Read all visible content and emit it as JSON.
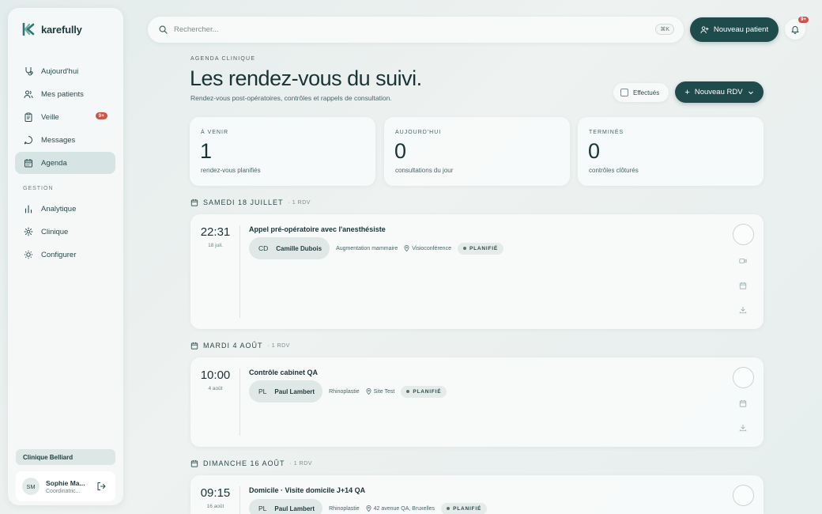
{
  "app": {
    "name": "karefully"
  },
  "sidebar": {
    "items": [
      {
        "label": "Aujourd'hui",
        "icon": "stethoscope-icon"
      },
      {
        "label": "Mes patients",
        "icon": "users-icon"
      },
      {
        "label": "Veille",
        "icon": "clipboard-icon",
        "badge": "9+"
      },
      {
        "label": "Messages",
        "icon": "message-icon"
      },
      {
        "label": "Agenda",
        "icon": "calendar-icon",
        "active": true
      }
    ],
    "section_label": "GESTION",
    "management": [
      {
        "label": "Analytique",
        "icon": "bar-chart-icon"
      },
      {
        "label": "Clinique",
        "icon": "gear-icon"
      },
      {
        "label": "Configurer",
        "icon": "sliders-icon"
      }
    ],
    "clinic": "Clinique Belliard",
    "user": {
      "initials": "SM",
      "name": "Sophie Ma...",
      "role": "Coordinatric..."
    }
  },
  "header": {
    "search_placeholder": "Rechercher...",
    "search_shortcut": "⌘K",
    "new_patient": "Nouveau patient",
    "notif_badge": "9+"
  },
  "page": {
    "eyebrow": "AGENDA CLINIQUE",
    "title": "Les rendez-vous du suivi.",
    "subtitle": "Rendez-vous post-opératoires, contrôles et rappels de consultation.",
    "filter_done": "Effectués",
    "new_rdv": "Nouveau RDV"
  },
  "stats": [
    {
      "label": "À VENIR",
      "value": "1",
      "desc": "rendez-vous planifiés"
    },
    {
      "label": "AUJOURD'HUI",
      "value": "0",
      "desc": "consultations du jour"
    },
    {
      "label": "TERMINÉS",
      "value": "0",
      "desc": "contrôles clôturés"
    }
  ],
  "days": [
    {
      "label": "SAMEDI 18 JUILLET",
      "count": "· 1 RDV",
      "appointment": {
        "time": "22:31",
        "date": "18 juil.",
        "title": "Appel pré-opératoire avec l'anesthésiste",
        "initials": "CD",
        "patient": "Camille Dubois",
        "procedure": "Augmentation mammaire",
        "location": "Visioconférence",
        "status": "PLANIFIÉ"
      }
    },
    {
      "label": "MARDI 4 AOÛT",
      "count": "· 1 RDV",
      "appointment": {
        "time": "10:00",
        "date": "4 août",
        "title": "Contrôle cabinet QA",
        "initials": "PL",
        "patient": "Paul Lambert",
        "procedure": "Rhinoplastie",
        "location": "Site Test",
        "status": "PLANIFIÉ"
      }
    },
    {
      "label": "DIMANCHE 16 AOÛT",
      "count": "· 1 RDV",
      "appointment": {
        "time": "09:15",
        "date": "16 août",
        "title": "Domicile · Visite domicile J+14 QA",
        "initials": "PL",
        "patient": "Paul Lambert",
        "procedure": "Rhinoplastie",
        "location": "42 avenue QA, Bruxelles",
        "status": "PLANIFIÉ"
      }
    }
  ]
}
